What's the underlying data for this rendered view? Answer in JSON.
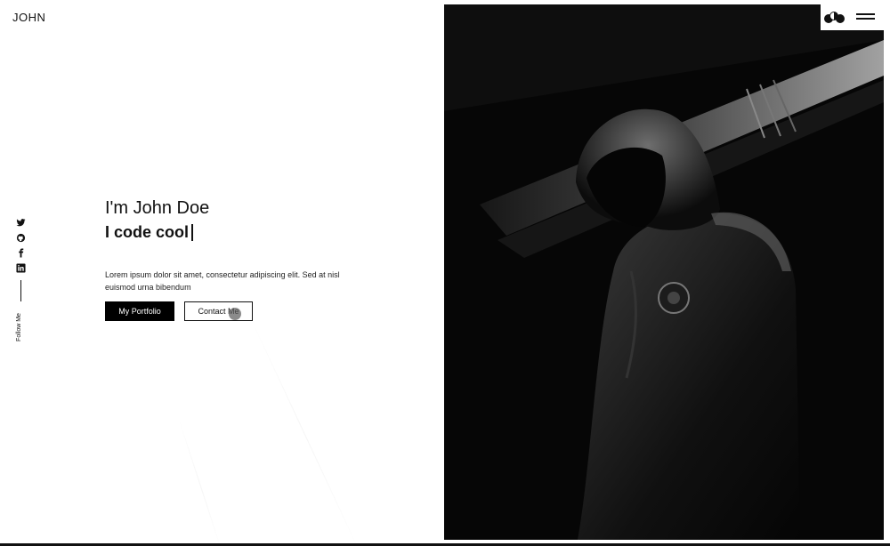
{
  "brand": {
    "logo_text": "JOHN"
  },
  "social": {
    "icons": [
      "twitter-icon",
      "github-icon",
      "facebook-icon",
      "linkedin-icon"
    ],
    "follow_label": "Follow Me"
  },
  "hero": {
    "greeting": "I'm John Doe",
    "tagline": "I code cool",
    "description": "Lorem ipsum dolor sit amet, consectetur adipiscing elit. Sed at nisl euismod urna bibendum"
  },
  "buttons": {
    "portfolio_label": "My Portfolio",
    "contact_label": "Contact Me"
  },
  "controls": {
    "theme_icon": "theme-toggle-icon",
    "menu_icon": "hamburger-menu-icon"
  },
  "colors": {
    "background": "#ffffff",
    "text": "#111111",
    "primary_button": "#000000",
    "photo_background": "#050505"
  }
}
